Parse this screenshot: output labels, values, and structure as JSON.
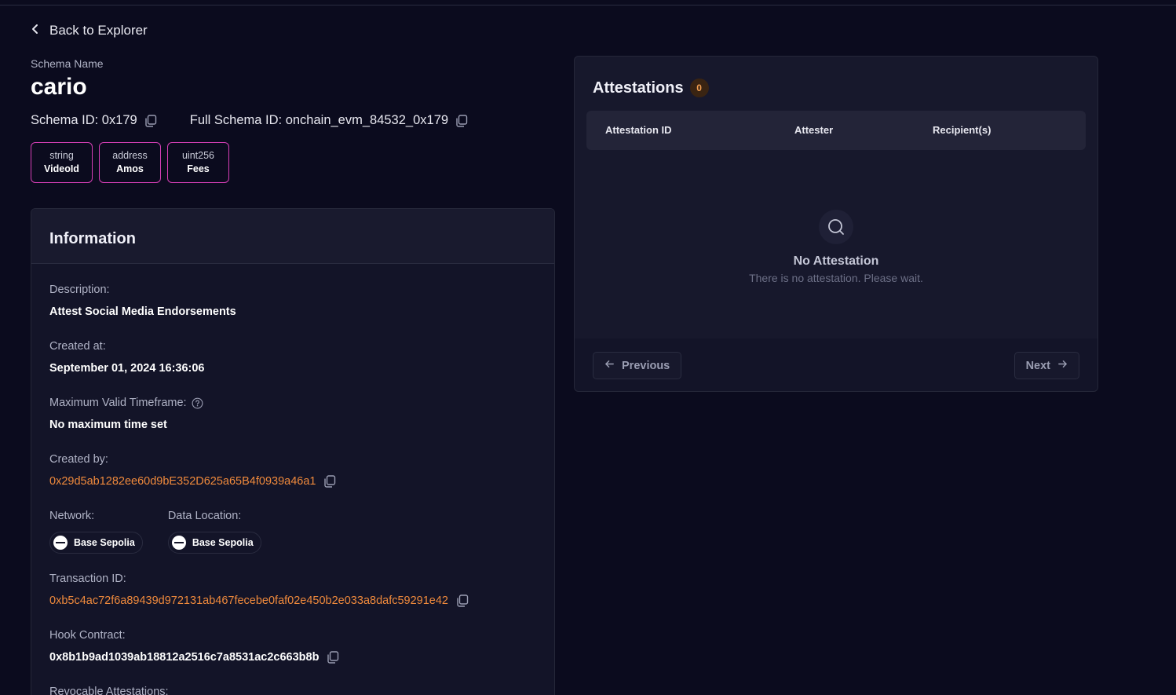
{
  "nav": {
    "back_label": "Back to Explorer"
  },
  "schema": {
    "name_label": "Schema Name",
    "name": "cario",
    "id_text": "Schema ID: 0x179",
    "full_id_text": "Full Schema ID: onchain_evm_84532_0x179",
    "fields": [
      {
        "type": "string",
        "name": "VideoId"
      },
      {
        "type": "address",
        "name": "Amos"
      },
      {
        "type": "uint256",
        "name": "Fees"
      }
    ]
  },
  "info": {
    "title": "Information",
    "description_label": "Description:",
    "description": "Attest Social Media Endorsements",
    "created_at_label": "Created at:",
    "created_at": "September 01, 2024 16:36:06",
    "max_timeframe_label": "Maximum Valid Timeframe:",
    "max_timeframe": "No maximum time set",
    "created_by_label": "Created by:",
    "created_by": "0x29d5ab1282ee60d9bE352D625a65B4f0939a46a1",
    "network_label": "Network:",
    "network": "Base Sepolia",
    "data_location_label": "Data Location:",
    "data_location": "Base Sepolia",
    "tx_label": "Transaction ID:",
    "tx_id": "0xb5c4ac72f6a89439d972131ab467fecebe0faf02e450b2e033a8dafc59291e42",
    "hook_label": "Hook Contract:",
    "hook": "0x8b1b9ad1039ab18812a2516c7a8531ac2c663b8b",
    "revocable_label": "Revocable Attestations:"
  },
  "attestations": {
    "title": "Attestations",
    "count": "0",
    "columns": [
      "Attestation ID",
      "Attester",
      "Recipient(s)"
    ],
    "empty_title": "No Attestation",
    "empty_sub": "There is no attestation. Please wait.",
    "prev_label": "Previous",
    "next_label": "Next"
  },
  "colors": {
    "accent": "#f08a3c",
    "chip_border": "#d63fb6",
    "background": "#0b0b1e"
  }
}
